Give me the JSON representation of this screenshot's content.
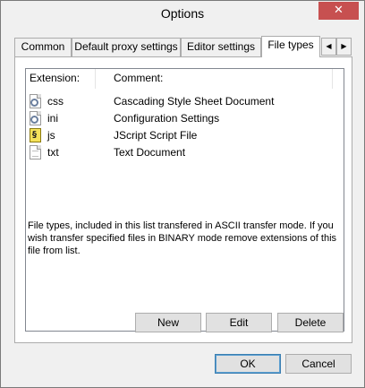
{
  "window": {
    "title": "Options",
    "close_glyph": "✕"
  },
  "tabs": [
    {
      "label": "Common"
    },
    {
      "label": "Default proxy settings"
    },
    {
      "label": "Editor settings"
    },
    {
      "label": "File types"
    }
  ],
  "tab_scroll": {
    "left": "◀",
    "right": "▶"
  },
  "listview": {
    "columns": [
      "Extension:",
      "Comment:"
    ],
    "rows": [
      {
        "icon": "config-file-icon",
        "ext": "css",
        "comment": "Cascading Style Sheet Document"
      },
      {
        "icon": "config-file-icon",
        "ext": "ini",
        "comment": "Configuration Settings"
      },
      {
        "icon": "jscript-file-icon",
        "ext": "js",
        "comment": "JScript Script File"
      },
      {
        "icon": "text-file-icon",
        "ext": "txt",
        "comment": "Text Document"
      }
    ]
  },
  "info": "File types, included in this list transfered in ASCII transfer mode. If you wish transfer specified files in BINARY mode remove extensions of this file from list.",
  "buttons": {
    "new": "New",
    "edit": "Edit",
    "delete": "Delete",
    "ok": "OK",
    "cancel": "Cancel"
  }
}
